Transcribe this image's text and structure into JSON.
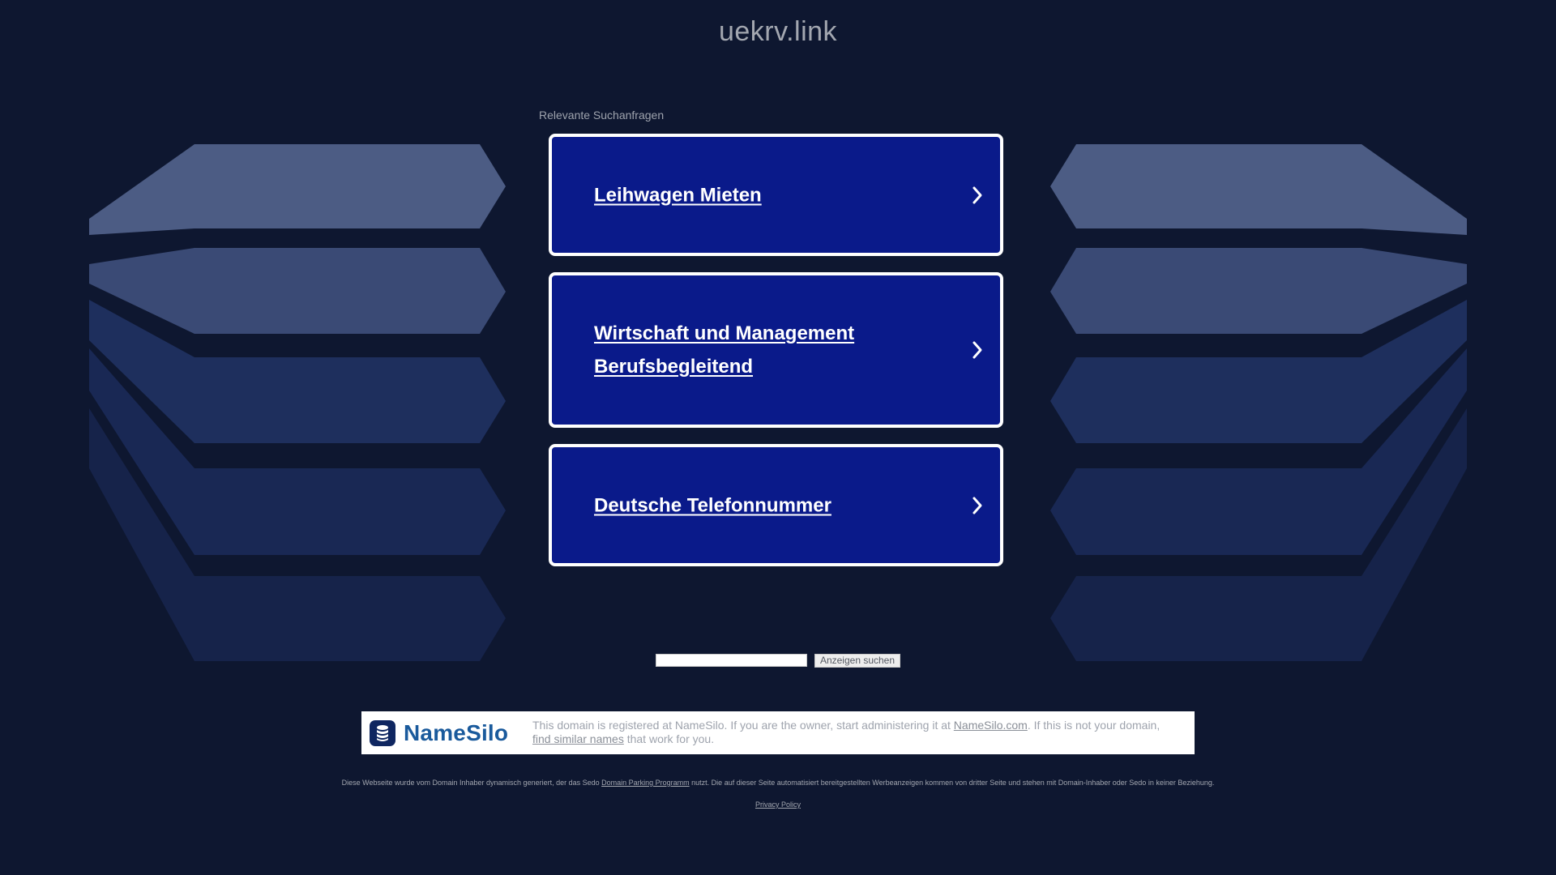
{
  "domain_name": "uekrv.link",
  "related_label": "Relevante Suchanfragen",
  "results": [
    {
      "line1": "Leihwagen Mieten",
      "line2": ""
    },
    {
      "line1": "Wirtschaft und Management",
      "line2": "Berufsbegleitend"
    },
    {
      "line1": "Deutsche Telefonnummer",
      "line2": ""
    }
  ],
  "search": {
    "input_value": "",
    "button_label": "Anzeigen suchen"
  },
  "namesilo": {
    "logo_text_name": "Name",
    "logo_text_silo": "Silo",
    "text_1": "This domain is registered at NameSilo. If you are the owner, start administering it at ",
    "link_1": "NameSilo.com",
    "text_2": ". If this is not your domain, ",
    "link_2": "find similar names",
    "text_3": " that work for you."
  },
  "footer": {
    "disclaimer_before": "Diese Webseite wurde vom Domain Inhaber dynamisch generiert, der das Sedo ",
    "disclaimer_link": "Domain Parking Programm",
    "disclaimer_after": " nutzt. Die auf dieser Seite automatisiert bereitgestellten Werbeanzeigen kommen von dritter Seite und stehen mit Domain-Inhaber oder Sedo in keiner Beziehung.",
    "privacy_label": "Privacy Policy"
  },
  "colors": {
    "background": "#0e1730",
    "card": "#0a1a8a",
    "card_border": "#ffffff",
    "muted_text": "#a3a7b0"
  }
}
